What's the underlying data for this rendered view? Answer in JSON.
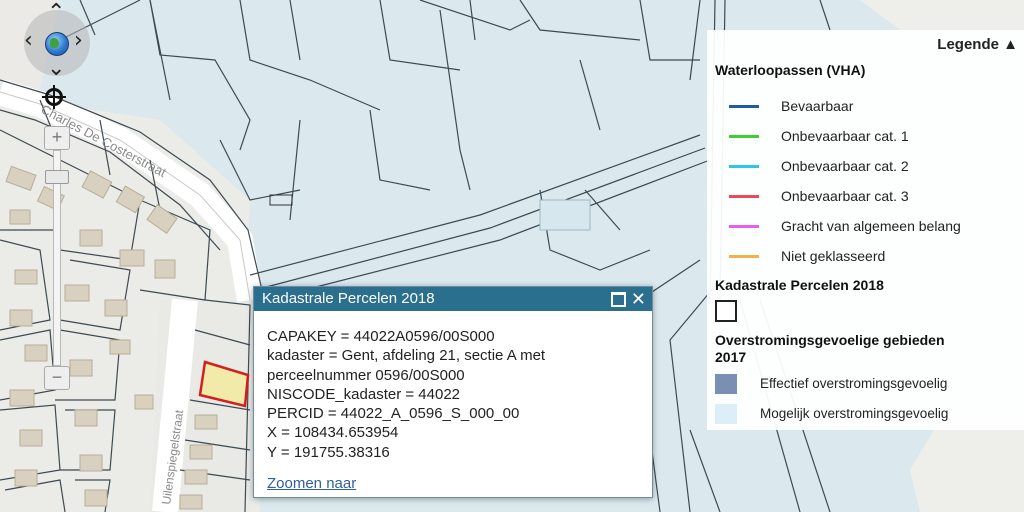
{
  "map": {
    "street_labels": [
      "Charles De Costerstraat",
      "Uilenspiegelstraat"
    ]
  },
  "legend": {
    "header": "Legende ▲",
    "sections": {
      "waterloop_title": "Waterloopassen (VHA)",
      "waterloop_items": [
        {
          "label": "Bevaarbaar",
          "color": "#1f5aa6"
        },
        {
          "label": "Onbevaarbaar cat. 1",
          "color": "#3cd12f"
        },
        {
          "label": "Onbevaarbaar cat. 2",
          "color": "#2ec3f0"
        },
        {
          "label": "Onbevaarbaar cat. 3",
          "color": "#ec4b55"
        },
        {
          "label": "Gracht van algemeen belang",
          "color": "#e85ef0"
        },
        {
          "label": "Niet geklasseerd",
          "color": "#f0b04a"
        }
      ],
      "kadaster_title": "Kadastrale Percelen 2018",
      "overstroming_title_line1": "Overstromingsgevoelige gebieden",
      "overstroming_title_line2": "2017",
      "overstroming_items": [
        {
          "label": "Effectief overstromingsgevoelig",
          "color": "#7a8fb3"
        },
        {
          "label": "Mogelijk overstromingsgevoelig",
          "color": "#dceef7"
        }
      ]
    }
  },
  "popup": {
    "title": "Kadastrale Percelen 2018",
    "lines": [
      "CAPAKEY = 44022A0596/00S000",
      "kadaster = Gent, afdeling 21, sectie A met",
      "perceelnummer 0596/00S000",
      "NISCODE_kadaster = 44022",
      "PERCID = 44022_A_0596_S_000_00",
      "X = 108434.653954",
      "Y = 191755.38316"
    ],
    "link": "Zoomen naar",
    "close_glyph": "✕"
  },
  "colors": {
    "flood_light": "#dbe9ef",
    "parcel_line": "#3e4a52",
    "road": "#ffffff",
    "building": "#d8d1bf",
    "selected_fill": "#f2eaa8",
    "selected_border": "#d21f1f",
    "popup_header": "#2a6f8e"
  }
}
